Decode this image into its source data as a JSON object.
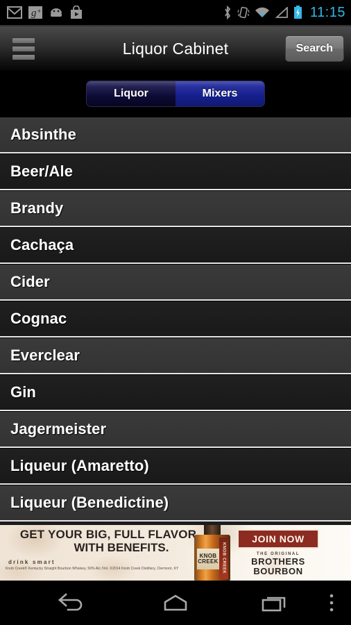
{
  "status_bar": {
    "left_icons": [
      "gmail-icon",
      "google-plus-icon",
      "android-robot-icon",
      "play-store-icon"
    ],
    "right_icons": [
      "bluetooth-icon",
      "vibrate-icon",
      "wifi-icon",
      "signal-icon",
      "battery-charging-icon"
    ],
    "time": "11:15",
    "clock_color": "#32b8e8"
  },
  "action_bar": {
    "menu_icon": "hamburger-menu-icon",
    "title": "Liquor Cabinet",
    "search_label": "Search"
  },
  "tabs": {
    "items": [
      {
        "label": "Liquor",
        "selected": false
      },
      {
        "label": "Mixers",
        "selected": true
      }
    ],
    "active_color": "#16208e",
    "inactive_color": "#0d0b36"
  },
  "list": {
    "items": [
      "Absinthe",
      "Beer/Ale",
      "Brandy",
      "Cachaça",
      "Cider",
      "Cognac",
      "Everclear",
      "Gin",
      "Jagermeister",
      "Liqueur (Amaretto)",
      "Liqueur (Benedictine)"
    ]
  },
  "ad": {
    "headline_line1": "GET YOUR BIG, FULL FLAVOR",
    "headline_line2": "WITH BENEFITS.",
    "drink_smart": "drink  smart",
    "legal": "Knob Creek® Kentucky Straight Bourbon Whiskey, 50% Alc./Vol. ©2014 Knob Creek Distillery, Clermont, KY",
    "bottle_label_line1": "KNOB",
    "bottle_label_line2": "CREEK",
    "bottle_strip_text": "KNOB CREEK",
    "cta": "JOIN NOW",
    "brand_tag": "THE ORIGINAL",
    "brand_line1": "BROTHERS",
    "brand_line2": "BOURBON",
    "cta_color": "#8c2b22"
  },
  "nav_bar": {
    "buttons": [
      "back-icon",
      "home-icon",
      "recents-icon",
      "overflow-menu-icon"
    ]
  }
}
